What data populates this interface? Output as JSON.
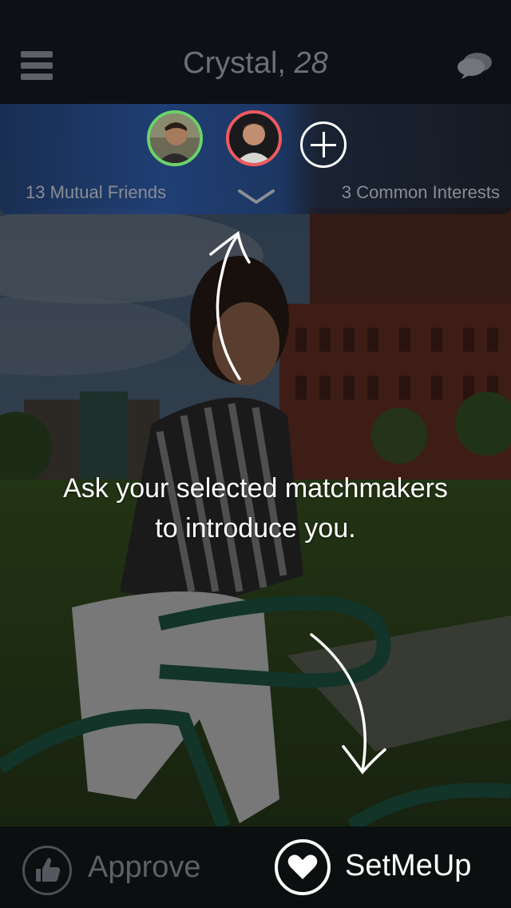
{
  "header": {
    "name": "Crystal,",
    "age": "28",
    "menu_icon": "hamburger-menu-icon",
    "chat_icon": "chat-bubbles-icon"
  },
  "matchmakers": {
    "avatars": [
      {
        "icon": "friend-avatar-1",
        "ring_color": "#6cd26a"
      },
      {
        "icon": "friend-avatar-2",
        "ring_color": "#ef5a5f"
      }
    ],
    "add_icon": "add-matchmaker-icon",
    "mutual_friends": "13 Mutual Friends",
    "common_interests": "3 Common Interests",
    "expand_icon": "chevron-down-icon"
  },
  "hint": {
    "line1": "Ask your selected matchmakers",
    "line2": "to introduce you."
  },
  "actions": {
    "approve_label": "Approve",
    "approve_icon": "thumbs-up-icon",
    "setmeup_label": "SetMeUp",
    "setmeup_icon": "heart-icon"
  },
  "colors": {
    "accent_green": "#6cd26a",
    "accent_red": "#ef5a5f",
    "text_muted": "#6d6f75"
  }
}
